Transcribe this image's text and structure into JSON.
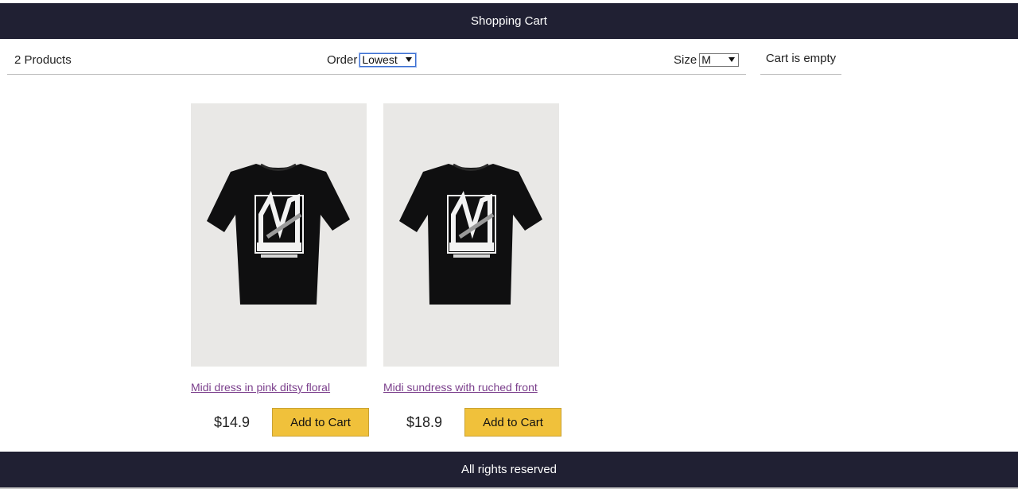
{
  "header": {
    "title": "Shopping Cart"
  },
  "filter": {
    "count_label": "2 Products",
    "order_label": "Order",
    "order_value": "Lowest",
    "size_label": "Size",
    "size_value": "M"
  },
  "cart": {
    "status": "Cart is empty"
  },
  "products": [
    {
      "title": "Midi dress in pink ditsy floral",
      "price": "$14.9",
      "button": "Add to Cart"
    },
    {
      "title": "Midi sundress with ruched front",
      "price": "$18.9",
      "button": "Add to Cart"
    }
  ],
  "footer": {
    "text": "All rights reserved"
  },
  "colors": {
    "header_bg": "#202033",
    "button_bg": "#f0c13b",
    "link": "#7b3f8c"
  }
}
